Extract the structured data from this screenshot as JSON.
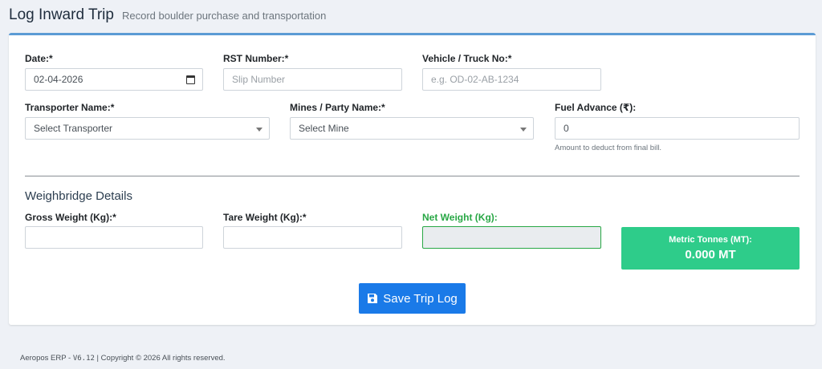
{
  "header": {
    "title": "Log Inward Trip",
    "subtitle": "Record boulder purchase and transportation"
  },
  "form": {
    "date": {
      "label": "Date:*",
      "value": "02-04-2026"
    },
    "rst_number": {
      "label": "RST Number:*",
      "placeholder": "Slip Number"
    },
    "vehicle": {
      "label": "Vehicle / Truck No:*",
      "placeholder": "e.g. OD-02-AB-1234"
    },
    "transporter": {
      "label": "Transporter Name:*",
      "selected": "Select Transporter"
    },
    "mines": {
      "label": "Mines / Party Name:*",
      "selected": "Select Mine"
    },
    "fuel_advance": {
      "label": "Fuel Advance (₹):",
      "value": "0",
      "help": "Amount to deduct from final bill."
    }
  },
  "weighbridge": {
    "title": "Weighbridge Details",
    "gross": {
      "label": "Gross Weight (Kg):*",
      "value": ""
    },
    "tare": {
      "label": "Tare Weight (Kg):*",
      "value": ""
    },
    "net": {
      "label": "Net Weight (Kg):",
      "value": ""
    },
    "mt": {
      "label": "Metric Tonnes (MT):",
      "value": "0.000 MT"
    }
  },
  "actions": {
    "save_label": "Save Trip Log"
  },
  "footer": {
    "app": "Aeropos ERP - ",
    "version": "V6.12",
    "copyright": " | Copyright © 2026 All rights reserved."
  },
  "colors": {
    "primary": "#1a7ae8",
    "success": "#2ecc8a",
    "net_label": "#28a745",
    "card_accent": "#5b9bd5"
  }
}
